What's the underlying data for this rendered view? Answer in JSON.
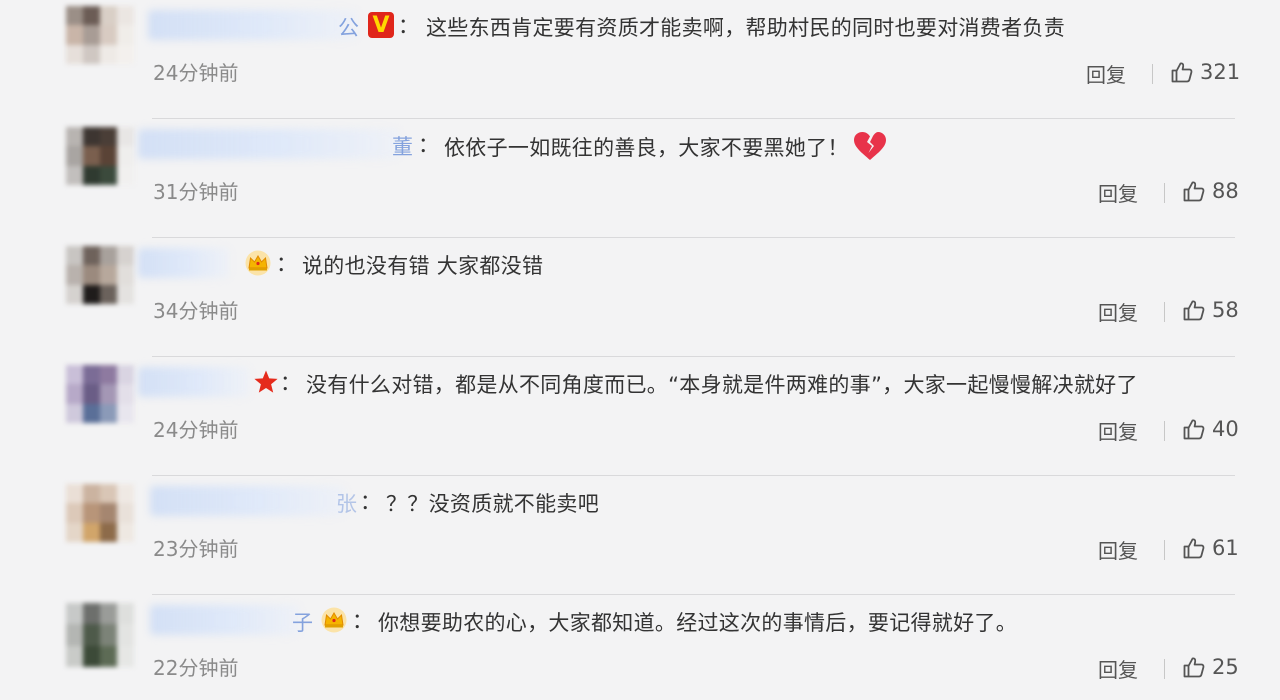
{
  "comments": [
    {
      "text": "这些东西肯定要有资质才能卖啊，帮助村民的同时也要对消费者负责",
      "nick_tail": "公",
      "badge": "v-badge",
      "emoji": null,
      "time": "24分钟前",
      "reply_label": "回复",
      "likes": "321"
    },
    {
      "text": "依依子一如既往的善良，大家不要黑她了！",
      "nick_tail": "董",
      "badge": null,
      "emoji": "broken-heart",
      "time": "31分钟前",
      "reply_label": "回复",
      "likes": "88"
    },
    {
      "text": "说的也没有错 大家都没错",
      "nick_tail": "",
      "badge": "crown",
      "emoji": null,
      "time": "34分钟前",
      "reply_label": "回复",
      "likes": "58"
    },
    {
      "text": "没有什么对错，都是从不同角度而已。“本身就是件两难的事”，大家一起慢慢解决就好了",
      "nick_tail": "",
      "badge": "star",
      "emoji": null,
      "time": "24分钟前",
      "reply_label": "回复",
      "likes": "40"
    },
    {
      "text": "？？没资质就不能卖吧",
      "nick_tail": "张",
      "badge": null,
      "emoji": null,
      "time": "23分钟前",
      "reply_label": "回复",
      "likes": "61"
    },
    {
      "text": "你想要助农的心，大家都知道。经过这次的事情后，要记得就好了。",
      "nick_tail": "子",
      "badge": "crown",
      "emoji": null,
      "time": "22分钟前",
      "reply_label": "回复",
      "likes": "25"
    }
  ],
  "colon": "：",
  "colors": {
    "background": "#f3f3f4",
    "text": "#333333",
    "meta": "#8a8a8a",
    "v_badge": "#e0261b",
    "v_letter": "#ffd900"
  }
}
